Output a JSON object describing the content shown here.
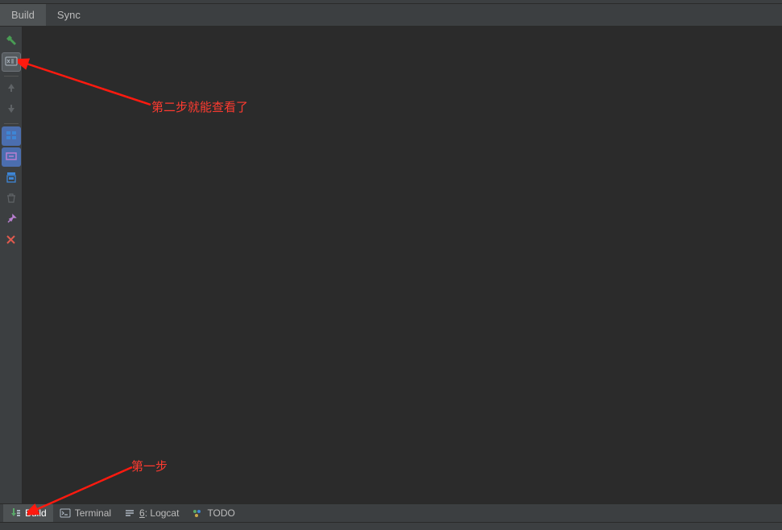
{
  "tabs": {
    "build": "Build",
    "sync": "Sync"
  },
  "toolbar": {
    "hammer": "build-icon",
    "toggle_view": "toggle-view-icon",
    "arrow_up": "arrow-up-icon",
    "arrow_down": "arrow-down-icon",
    "filter1": "expand-icon",
    "filter2": "collapse-icon",
    "export": "export-icon",
    "trash": "trash-icon",
    "pin": "pin-icon",
    "close": "close-icon"
  },
  "bottom": {
    "build": "Build",
    "terminal": "Terminal",
    "logcat_prefix": "6",
    "logcat_label": ": Logcat",
    "todo": "TODO"
  },
  "annotations": {
    "step1": "第一步",
    "step2": "第二步就能查看了"
  },
  "status": {
    "text": ""
  }
}
